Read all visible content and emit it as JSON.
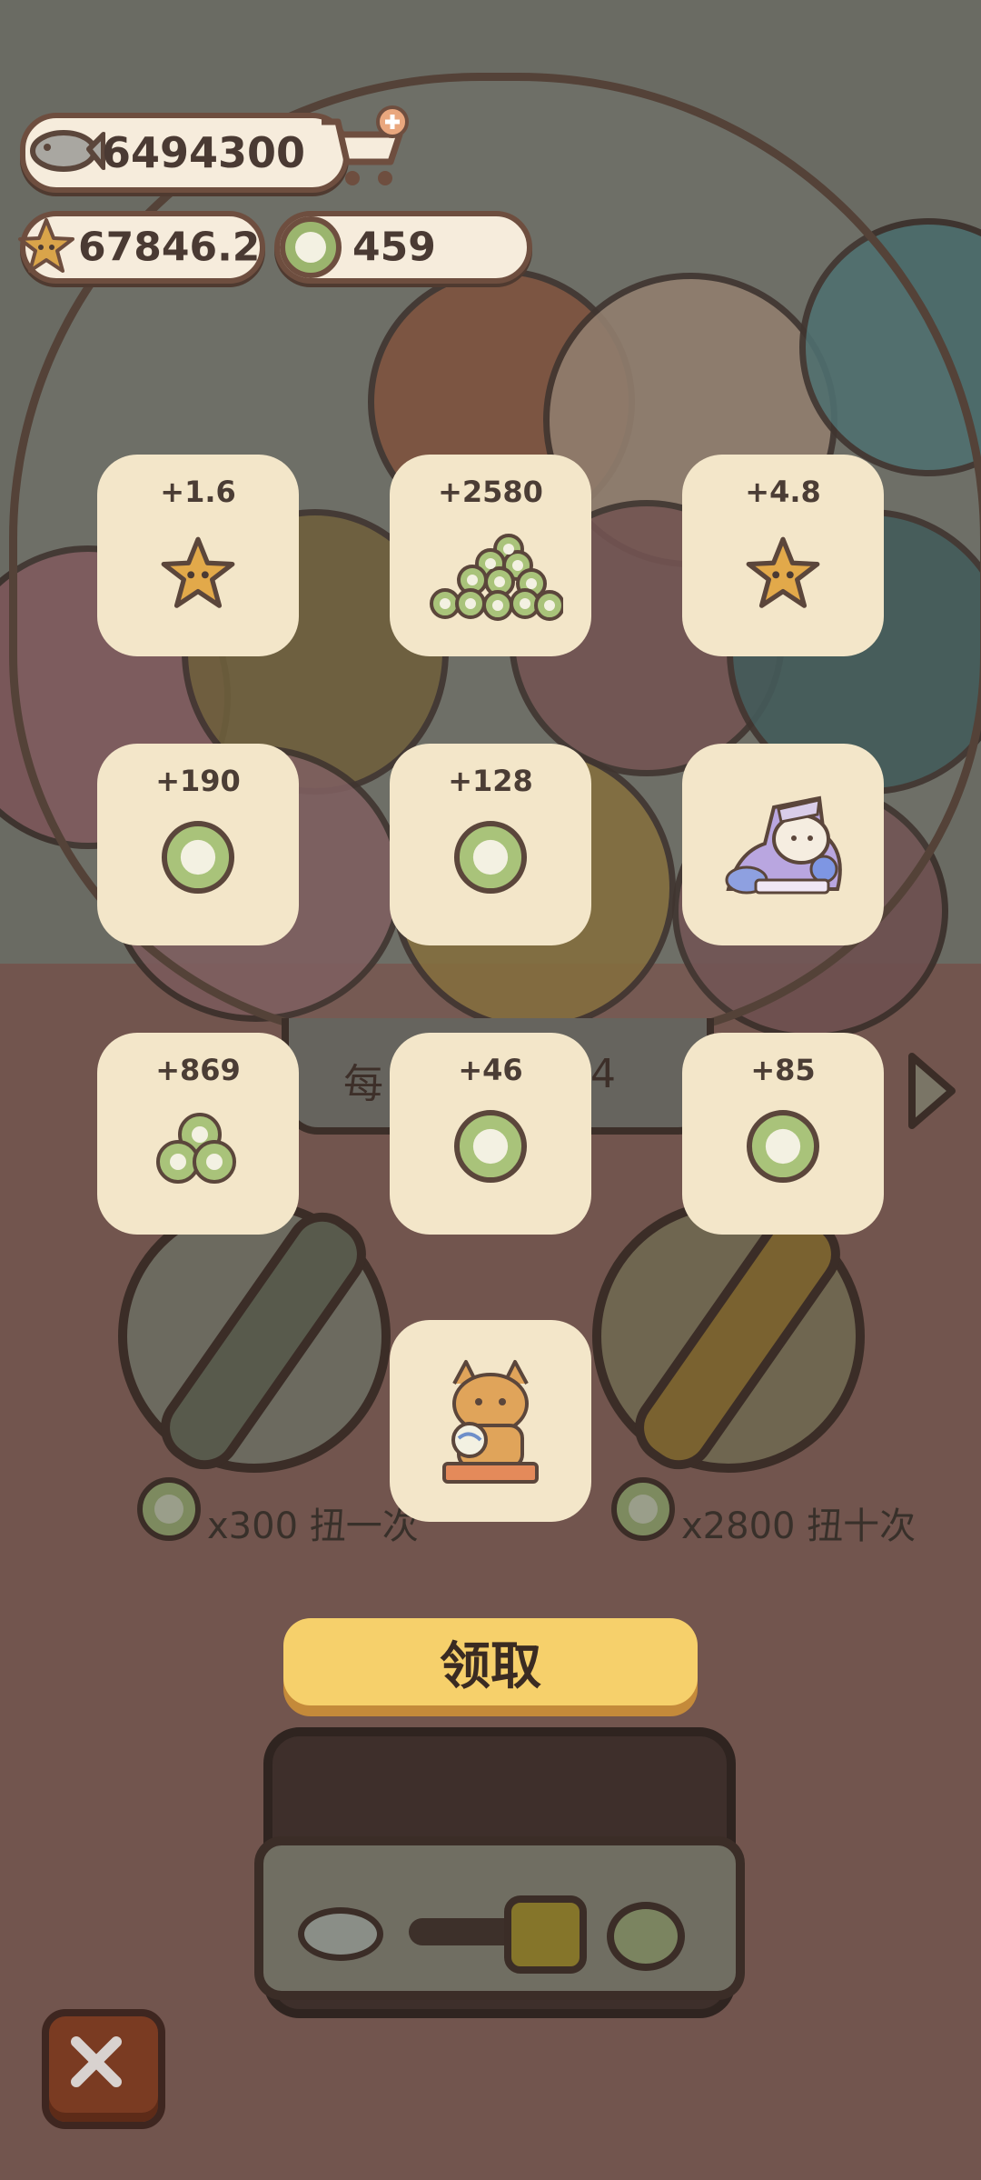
{
  "currency": {
    "fish": "6494300",
    "stars": "67846.2",
    "coins": "459"
  },
  "rewards": [
    {
      "amount": "+1.6",
      "icon": "star-icon"
    },
    {
      "amount": "+2580",
      "icon": "coin-pile-icon"
    },
    {
      "amount": "+4.8",
      "icon": "star-icon"
    },
    {
      "amount": "+190",
      "icon": "coin-icon"
    },
    {
      "amount": "+128",
      "icon": "coin-icon"
    },
    {
      "amount": "",
      "icon": "cat-character-purple-icon"
    },
    {
      "amount": "+869",
      "icon": "coin-stack-icon"
    },
    {
      "amount": "+46",
      "icon": "coin-icon"
    },
    {
      "amount": "+85",
      "icon": "coin-icon"
    },
    {
      "amount": "",
      "icon": "cat-character-lynx-icon"
    }
  ],
  "background": {
    "note_left": "每",
    "note_right": "4",
    "spin_once": "x300 扭一次",
    "spin_ten": "x2800 扭十次"
  },
  "claim_label": "领取",
  "colors": {
    "tile": "#f3e6c9",
    "claim": "#f6d06b",
    "coin_green": "#9bb56e",
    "star": "#e2a94a"
  }
}
